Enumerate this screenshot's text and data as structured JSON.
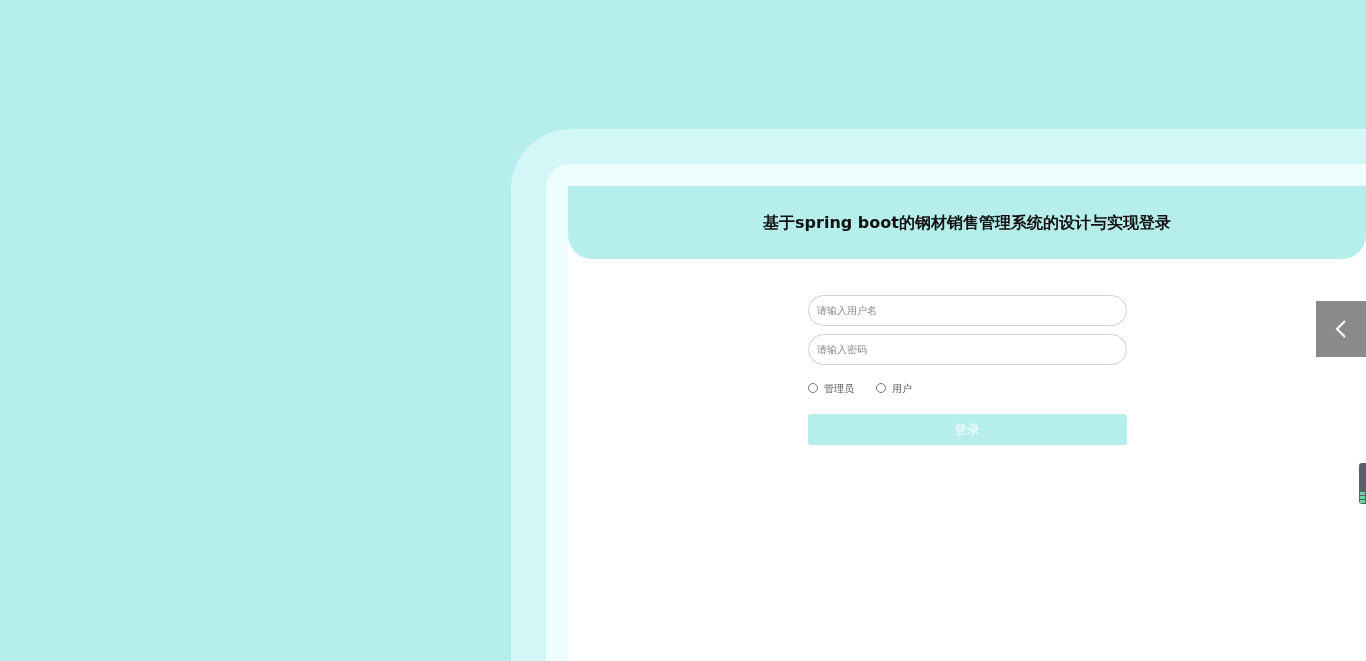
{
  "header": {
    "title": "基于spring boot的钢材销售管理系统的设计与实现登录"
  },
  "form": {
    "username": {
      "placeholder": "请输入用户名"
    },
    "password": {
      "placeholder": "请输入密码"
    },
    "roles": [
      {
        "label": "管理员",
        "selected": false
      },
      {
        "label": "用户",
        "selected": false
      }
    ],
    "submit": "登录"
  }
}
